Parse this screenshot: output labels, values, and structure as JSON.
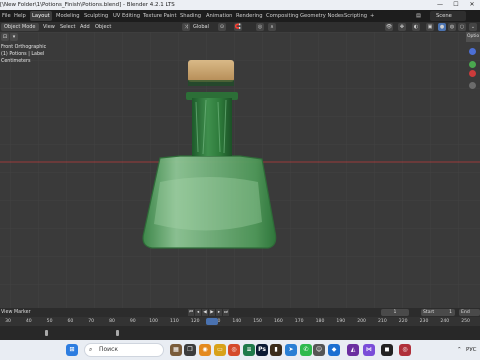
{
  "window": {
    "title": "[\\New Folder\\1\\Potions_Finish\\Potions.blend] - Blender 4.2.1 LTS",
    "minimize": "—",
    "maximize": "☐",
    "close": "✕"
  },
  "menubar": {
    "items": [
      "File",
      "Help",
      "Layout",
      "Modeling",
      "Sculpting",
      "UV Editing",
      "Texture Paint",
      "Shading",
      "Animation",
      "Rendering",
      "Compositing",
      "Geometry Nodes",
      "Scripting"
    ],
    "active": "Layout",
    "add": "+",
    "scene": "Scene"
  },
  "toolbar": {
    "mode": "Object Mode",
    "menus": [
      "View",
      "Select",
      "Add",
      "Object"
    ],
    "orientation": "Global"
  },
  "viewport": {
    "view_name": "Front Orthographic",
    "collection": "(1) Potions | Label",
    "units": "Centimeters",
    "options": "Optio",
    "background_color": "#3a3a3a"
  },
  "bottombar": {
    "menus": [
      "View",
      "Marker"
    ],
    "current_frame": "1",
    "start_label": "Start",
    "start_value": "1",
    "end_label": "End"
  },
  "timeline": {
    "ticks": [
      "30",
      "40",
      "50",
      "60",
      "70",
      "80",
      "90",
      "100",
      "110",
      "120",
      "130",
      "140",
      "150",
      "160",
      "170",
      "180",
      "190",
      "200",
      "210",
      "220",
      "230",
      "240",
      "250"
    ]
  },
  "taskbar": {
    "search_placeholder": "Поиск",
    "language": "РУС"
  },
  "colors": {
    "accent_blue": "#4a72b0",
    "axis_red": "#9b3b3b",
    "glass_green": "#5fa26a",
    "cork": "#caa36f"
  }
}
